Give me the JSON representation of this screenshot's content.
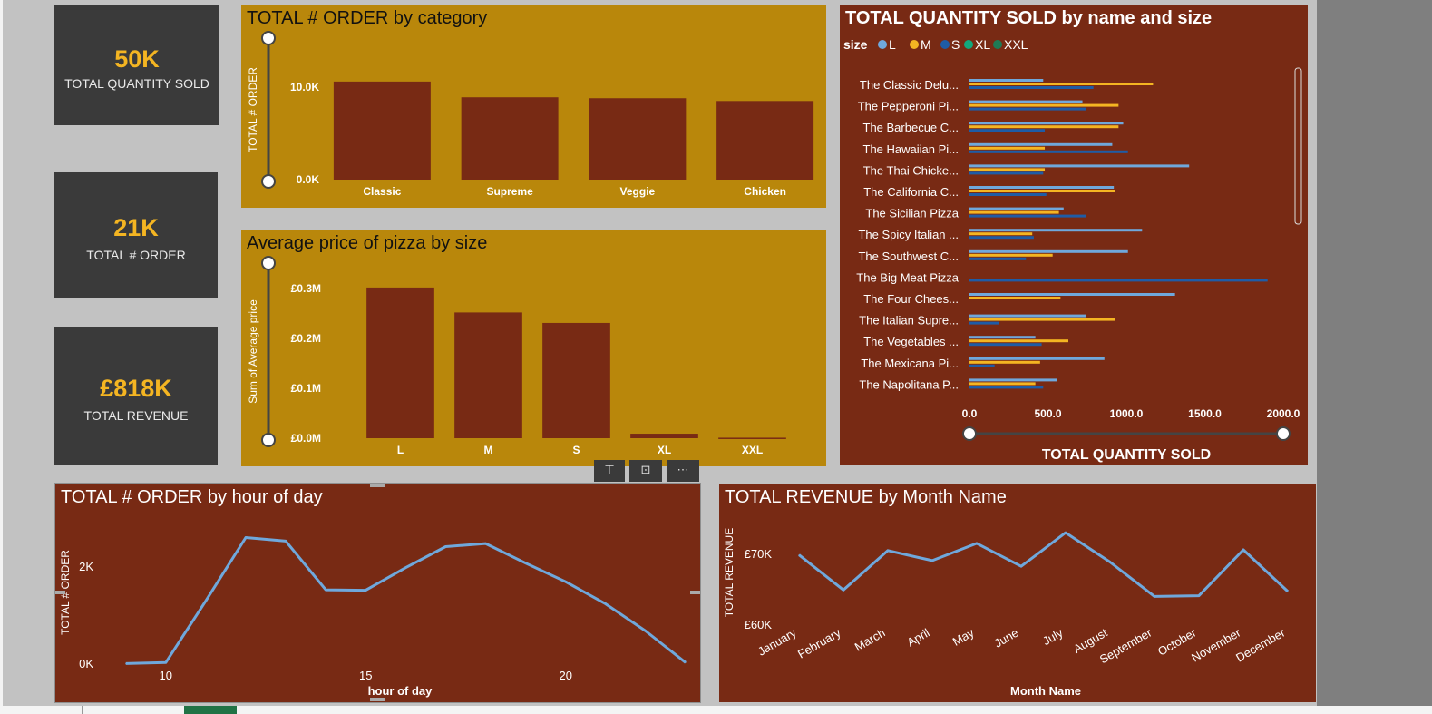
{
  "kpis": {
    "quantity": {
      "value": "50K",
      "label": "TOTAL QUANTITY SOLD"
    },
    "orders": {
      "value": "21K",
      "label": "TOTAL # ORDER"
    },
    "revenue": {
      "value": "£818K",
      "label": "TOTAL REVENUE"
    }
  },
  "colors": {
    "gold": "#b9870b",
    "brown": "#782a14",
    "kpi_value": "#f4b522",
    "line": "#6fa8dc",
    "L": "#6fa8dc",
    "M": "#f4b522",
    "S": "#1f5ca6"
  },
  "titles": {
    "orders_by_category": "TOTAL # ORDER by category",
    "avg_price_by_size": "Average price of pizza by size",
    "qty_by_name_size": "TOTAL QUANTITY SOLD by name and size",
    "orders_by_hour": "TOTAL # ORDER by hour of day",
    "revenue_by_month": "TOTAL REVENUE by Month Name"
  },
  "chart_data": [
    {
      "id": "orders_by_category",
      "type": "bar",
      "title": "TOTAL # ORDER by category",
      "ylabel": "TOTAL # ORDER",
      "xlabel": "",
      "categories": [
        "Classic",
        "Supreme",
        "Veggie",
        "Chicken"
      ],
      "values": [
        10600,
        8900,
        8800,
        8500
      ],
      "ylim": [
        0,
        10000
      ],
      "yticks": [
        "0.0K",
        "10.0K"
      ],
      "grid": false
    },
    {
      "id": "avg_price_by_size",
      "type": "bar",
      "title": "Average price of pizza by size",
      "ylabel": "Sum of Average price",
      "xlabel": "",
      "categories": [
        "L",
        "M",
        "S",
        "XL",
        "XXL"
      ],
      "values": [
        302000,
        252000,
        231000,
        9000,
        1000
      ],
      "ylim": [
        0,
        300000
      ],
      "yticks": [
        "£0.0M",
        "£0.1M",
        "£0.2M",
        "£0.3M"
      ],
      "grid": false
    },
    {
      "id": "qty_by_name_size",
      "type": "bar",
      "orientation": "horizontal",
      "title": "TOTAL QUANTITY SOLD by name and size",
      "xlabel": "TOTAL QUANTITY SOLD",
      "legend_title": "size",
      "legend": [
        "L",
        "M",
        "S",
        "XL",
        "XXL"
      ],
      "legend_position": "top-left",
      "xlim": [
        0,
        2000
      ],
      "xticks": [
        "0.0",
        "500.0",
        "1000.0",
        "1500.0",
        "2000.0"
      ],
      "categories": [
        "The Classic Delu...",
        "The Pepperoni Pi...",
        "The Barbecue C...",
        "The Hawaiian Pi...",
        "The Thai Chicke...",
        "The California C...",
        "The Sicilian Pizza",
        "The Spicy Italian ...",
        "The Southwest C...",
        "The Big Meat Pizza",
        "The Four Chees...",
        "The Italian Supre...",
        "The Vegetables ...",
        "The Mexicana Pi...",
        "The Napolitana P..."
      ],
      "series": [
        {
          "name": "L",
          "values": [
            470,
            720,
            980,
            910,
            1400,
            920,
            600,
            1100,
            1010,
            0,
            1310,
            740,
            420,
            860,
            560
          ]
        },
        {
          "name": "M",
          "values": [
            1170,
            950,
            950,
            480,
            480,
            930,
            570,
            400,
            530,
            0,
            580,
            930,
            630,
            450,
            420
          ]
        },
        {
          "name": "S",
          "values": [
            790,
            740,
            480,
            1010,
            470,
            490,
            740,
            410,
            360,
            1900,
            0,
            190,
            460,
            160,
            470
          ]
        }
      ]
    },
    {
      "id": "orders_by_hour",
      "type": "line",
      "title": "TOTAL # ORDER by hour of day",
      "xlabel": "hour of day",
      "ylabel": "TOTAL # ORDER",
      "x": [
        9,
        10,
        11,
        12,
        13,
        14,
        15,
        16,
        17,
        18,
        19,
        20,
        21,
        22,
        23
      ],
      "y": [
        10,
        30,
        1260,
        2520,
        2450,
        1480,
        1470,
        1920,
        2340,
        2400,
        2010,
        1640,
        1200,
        660,
        30
      ],
      "xlim": [
        8.1,
        23
      ],
      "ylim": [
        0,
        2800
      ],
      "xticks": [
        10,
        15,
        20
      ],
      "yticks": [
        "0K",
        "2K"
      ],
      "grid": false
    },
    {
      "id": "revenue_by_month",
      "type": "line",
      "title": "TOTAL REVENUE by Month Name",
      "xlabel": "Month Name",
      "ylabel": "TOTAL REVENUE",
      "categories": [
        "January",
        "February",
        "March",
        "April",
        "May",
        "June",
        "July",
        "August",
        "September",
        "October",
        "November",
        "December"
      ],
      "values": [
        69800,
        64900,
        70400,
        69000,
        71400,
        68200,
        72900,
        68800,
        64000,
        64100,
        70500,
        64700
      ],
      "ylim": [
        60000,
        77000
      ],
      "yticks": [
        "£60K",
        "£70K"
      ],
      "grid": false
    }
  ]
}
